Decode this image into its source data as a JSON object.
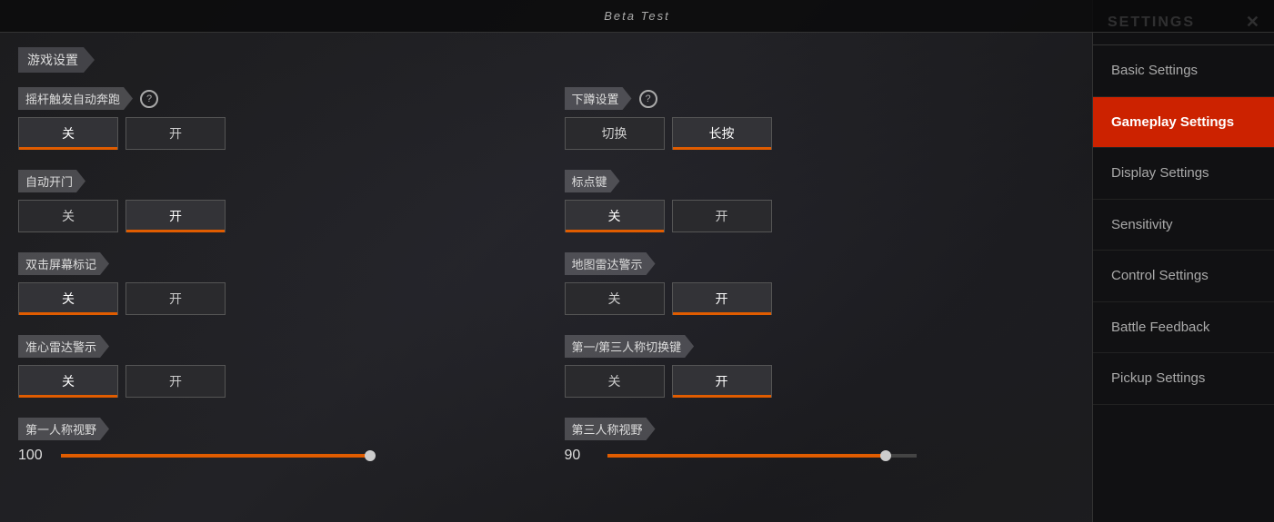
{
  "topBar": {
    "title": "Beta Test"
  },
  "sectionTitle": "游戏设置",
  "settings": {
    "left": [
      {
        "id": "auto-sprint",
        "label": "摇杆触发自动奔跑",
        "hasHelp": true,
        "type": "toggle",
        "options": [
          "关",
          "开"
        ],
        "activeIndex": 0
      },
      {
        "id": "auto-door",
        "label": "自动开门",
        "hasHelp": false,
        "type": "toggle",
        "options": [
          "关",
          "开"
        ],
        "activeIndex": 1
      },
      {
        "id": "double-tap-mark",
        "label": "双击屏幕标记",
        "hasHelp": false,
        "type": "toggle",
        "options": [
          "关",
          "开"
        ],
        "activeIndex": 0
      },
      {
        "id": "aim-radar",
        "label": "准心雷达警示",
        "hasHelp": false,
        "type": "toggle",
        "options": [
          "关",
          "开"
        ],
        "activeIndex": 0
      },
      {
        "id": "fov-first",
        "label": "第一人称视野",
        "hasHelp": false,
        "type": "slider",
        "value": 100,
        "maxValue": 100
      }
    ],
    "right": [
      {
        "id": "crouch-setting",
        "label": "下蹲设置",
        "hasHelp": true,
        "type": "toggle",
        "options": [
          "切换",
          "长按"
        ],
        "activeIndex": 1
      },
      {
        "id": "mark-key",
        "label": "标点键",
        "hasHelp": false,
        "type": "toggle",
        "options": [
          "关",
          "开"
        ],
        "activeIndex": 0
      },
      {
        "id": "map-radar",
        "label": "地图雷达警示",
        "hasHelp": false,
        "type": "toggle",
        "options": [
          "关",
          "开"
        ],
        "activeIndex": 1
      },
      {
        "id": "perspective-switch",
        "label": "第一/第三人称切换键",
        "hasHelp": false,
        "type": "toggle",
        "options": [
          "关",
          "开"
        ],
        "activeIndex": 1
      },
      {
        "id": "fov-third",
        "label": "第三人称视野",
        "hasHelp": false,
        "type": "slider",
        "value": 90,
        "maxValue": 100
      }
    ]
  },
  "sidebar": {
    "title": "SETTINGS",
    "closeIcon": "✕",
    "navItems": [
      {
        "id": "basic",
        "label": "Basic Settings",
        "active": false
      },
      {
        "id": "gameplay",
        "label": "Gameplay Settings",
        "active": true
      },
      {
        "id": "display",
        "label": "Display Settings",
        "active": false
      },
      {
        "id": "sensitivity",
        "label": "Sensitivity",
        "active": false
      },
      {
        "id": "control",
        "label": "Control Settings",
        "active": false
      },
      {
        "id": "battle",
        "label": "Battle Feedback",
        "active": false
      },
      {
        "id": "pickup",
        "label": "Pickup Settings",
        "active": false
      }
    ]
  }
}
